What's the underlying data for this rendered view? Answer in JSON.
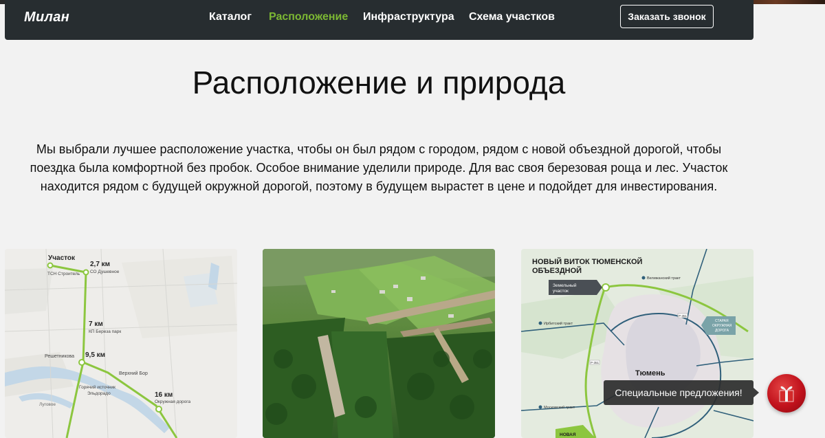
{
  "brand": {
    "logo": "Милан"
  },
  "nav": {
    "items": [
      {
        "label": "Каталог",
        "active": false
      },
      {
        "label": "Расположение",
        "active": true
      },
      {
        "label": "Инфраструктура",
        "active": false
      },
      {
        "label": "Схема участков",
        "active": false
      }
    ],
    "cta_label": "Заказать звонок"
  },
  "section": {
    "title": "Расположение и природа",
    "intro": "Мы выбрали лучшее расположение участка, чтобы он был рядом с городом, рядом с новой объездной дорогой, чтобы поездка была комфортной без пробок. Особое внимание уделили природе. Для вас своя березовая роща и лес. Участок находится рядом с будущей окружной дорогой, поэтому в будущем вырастет в цене и подойдет для инвестирования."
  },
  "route_map": {
    "start": "Участок",
    "start_sub": "ТСН Строитель",
    "points": [
      {
        "km": "2,7 км",
        "place": "СО Душевное"
      },
      {
        "km": "7 км",
        "place": "КП Береза парк"
      },
      {
        "km": "9,5 км",
        "place": ""
      },
      {
        "km": "16 км",
        "place": "Окружная дорога"
      }
    ],
    "labels": [
      "Решетникова",
      "Верхний Бор",
      "Горячий источник",
      "Эльдорадо",
      "Луговое"
    ]
  },
  "bypass_map": {
    "title_line1": "НОВЫЙ ВИТОК ТЮМЕНСКОЙ",
    "title_line2": "ОБЪЕЗДНОЙ",
    "plot_line1": "Земельный",
    "plot_line2": "участок",
    "roads": [
      "Велижанский тракт",
      "Ирбитский тракт",
      "Московский тракт"
    ],
    "old_ring": [
      "СТАРАЯ",
      "ОКРУЖНАЯ",
      "ДОРОГА"
    ],
    "city": "Тюмень",
    "new_label": "НОВАЯ",
    "road_codes": [
      "Р-351",
      "Р-351"
    ]
  },
  "promo": {
    "special_label": "Специальные предложения!"
  },
  "colors": {
    "accent": "#7cb833",
    "navbar": "#272d30",
    "background": "#f2f2f2"
  }
}
